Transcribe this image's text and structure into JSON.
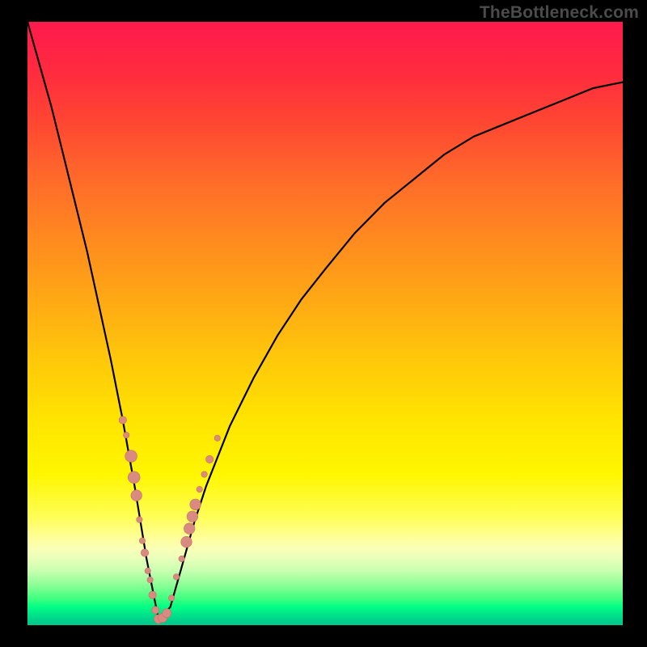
{
  "watermark": "TheBottleneck.com",
  "colors": {
    "bg": "#000000",
    "curve": "#000000",
    "marker_fill": "#d98b82",
    "marker_stroke": "#c66e63"
  },
  "chart_data": {
    "type": "line",
    "title": "",
    "xlabel": "",
    "ylabel": "",
    "xlim": [
      0,
      100
    ],
    "ylim": [
      0,
      100
    ],
    "grid": false,
    "legend": false,
    "note": "V-shaped bottleneck curve; x is relative component scale, y is mismatch severity (0 best). Minimum near x≈22. Values estimated from pixel positions.",
    "series": [
      {
        "name": "bottleneck-curve",
        "x": [
          0,
          2,
          4,
          6,
          8,
          10,
          12,
          14,
          16,
          18,
          20,
          22,
          24,
          26,
          28,
          30,
          34,
          38,
          42,
          46,
          50,
          55,
          60,
          65,
          70,
          75,
          80,
          85,
          90,
          95,
          100
        ],
        "values": [
          100,
          93,
          86,
          78,
          70,
          62,
          53,
          44,
          34,
          23,
          11,
          1,
          3,
          10,
          17,
          23,
          33,
          41,
          48,
          54,
          59,
          65,
          70,
          74,
          78,
          81,
          83,
          85,
          87,
          89,
          90
        ]
      }
    ],
    "markers": [
      {
        "x": 16.0,
        "y": 34.0,
        "r": 1.5
      },
      {
        "x": 16.6,
        "y": 31.5,
        "r": 1.2
      },
      {
        "x": 17.4,
        "y": 28.0,
        "r": 2.4
      },
      {
        "x": 17.9,
        "y": 24.5,
        "r": 2.4
      },
      {
        "x": 18.3,
        "y": 21.5,
        "r": 2.2
      },
      {
        "x": 18.8,
        "y": 17.5,
        "r": 1.2
      },
      {
        "x": 19.3,
        "y": 14.0,
        "r": 1.2
      },
      {
        "x": 19.7,
        "y": 12.0,
        "r": 1.5
      },
      {
        "x": 20.2,
        "y": 9.0,
        "r": 1.2
      },
      {
        "x": 20.6,
        "y": 7.5,
        "r": 1.2
      },
      {
        "x": 21.0,
        "y": 5.0,
        "r": 1.5
      },
      {
        "x": 21.5,
        "y": 2.5,
        "r": 1.5
      },
      {
        "x": 22.0,
        "y": 1.0,
        "r": 1.8
      },
      {
        "x": 22.7,
        "y": 1.2,
        "r": 1.8
      },
      {
        "x": 23.4,
        "y": 2.0,
        "r": 1.8
      },
      {
        "x": 24.2,
        "y": 4.5,
        "r": 1.2
      },
      {
        "x": 25.0,
        "y": 8.0,
        "r": 1.2
      },
      {
        "x": 25.9,
        "y": 11.0,
        "r": 1.2
      },
      {
        "x": 26.7,
        "y": 13.8,
        "r": 2.2
      },
      {
        "x": 27.2,
        "y": 16.0,
        "r": 2.2
      },
      {
        "x": 27.7,
        "y": 18.0,
        "r": 2.2
      },
      {
        "x": 28.2,
        "y": 20.0,
        "r": 2.2
      },
      {
        "x": 28.9,
        "y": 22.5,
        "r": 1.2
      },
      {
        "x": 29.7,
        "y": 25.0,
        "r": 1.2
      },
      {
        "x": 30.6,
        "y": 27.5,
        "r": 1.5
      },
      {
        "x": 31.9,
        "y": 31.0,
        "r": 1.2
      }
    ]
  }
}
